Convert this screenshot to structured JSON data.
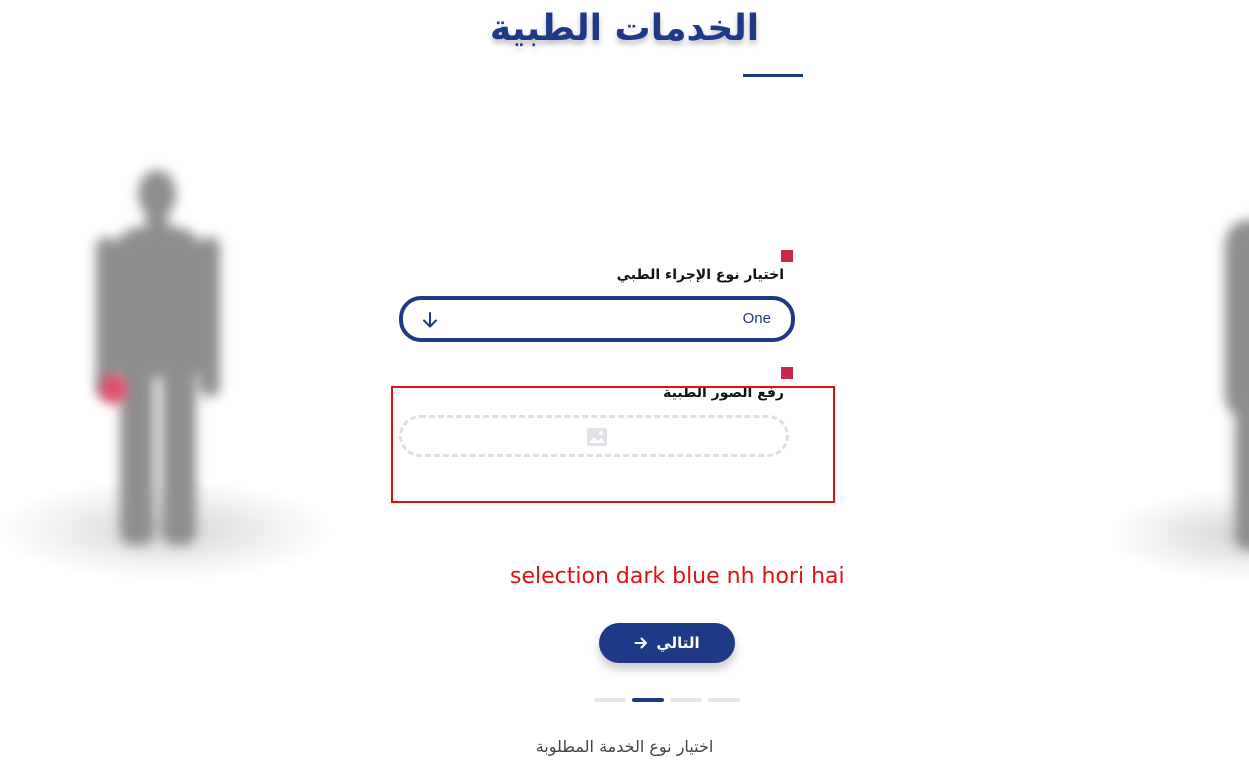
{
  "header": {
    "title": "الخدمات الطبية"
  },
  "form": {
    "procedure_label": "اختيار نوع الإجراء الطبي",
    "procedure_selected": "One",
    "upload_label": "رفع الصور الطبية"
  },
  "annotation": {
    "note": "selection dark blue nh hori hai"
  },
  "navigation": {
    "next_label": "التالي"
  },
  "steps": {
    "total": 4,
    "active": 2,
    "caption": "اختيار نوع الخدمة المطلوبة"
  },
  "icons": {
    "select_arrow": "arrow-down-icon",
    "upload": "image-icon",
    "next": "arrow-right-icon"
  },
  "colors": {
    "brand": "#1e3a86",
    "required_marker": "#c9264b",
    "annotation": "#e01010",
    "step_inactive": "#e3e6eb"
  }
}
